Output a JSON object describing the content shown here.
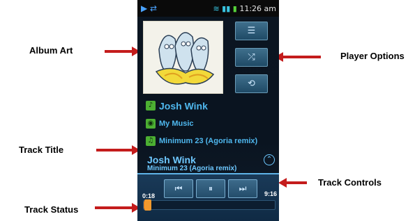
{
  "annotations": {
    "album_art": "Album Art",
    "player_options": "Player Options",
    "track_title": "Track Title",
    "track_controls": "Track Controls",
    "track_status": "Track Status"
  },
  "status_bar": {
    "time": "11:26 am",
    "icons": [
      "play-icon",
      "usb-icon",
      "wifi-icon",
      "signal-icon",
      "signal-icon",
      "battery-icon"
    ]
  },
  "player_options": [
    {
      "name": "playlist-icon",
      "glyph": "☰"
    },
    {
      "name": "shuffle-icon",
      "glyph": "⤮"
    },
    {
      "name": "repeat-icon",
      "glyph": "⟲"
    }
  ],
  "track_info": {
    "artist": "Josh Wink",
    "library": "My Music",
    "album_track": "Minimum 23 (Agoria remix)"
  },
  "now_playing": {
    "artist": "Josh Wink",
    "track": "Minimum 23 (Agoria remix)"
  },
  "controls": {
    "elapsed": "0:18",
    "duration": "9:16",
    "progress_fraction": 0.033
  },
  "colors": {
    "accent": "#4fb8ef",
    "annotation_arrow": "#c41c1c",
    "seek_fill": "#e0781a"
  }
}
